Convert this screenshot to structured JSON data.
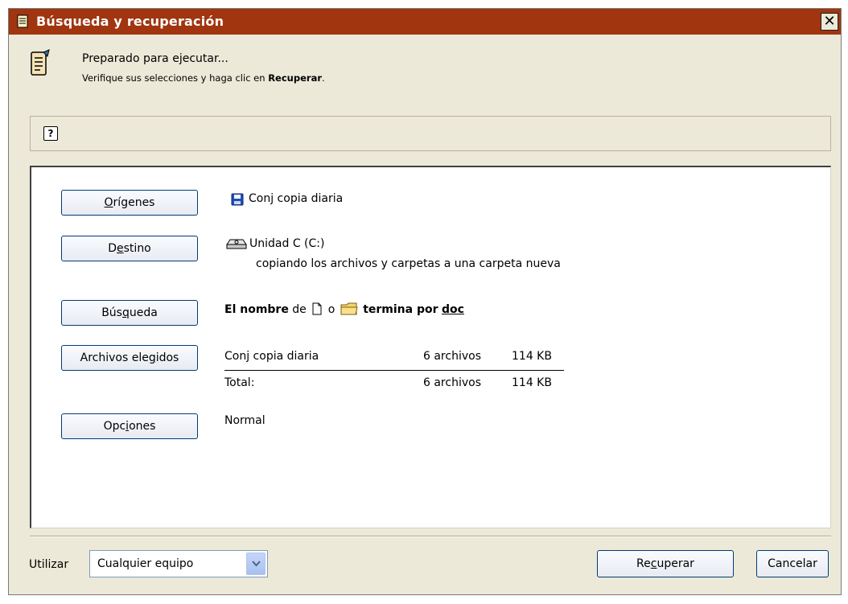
{
  "window": {
    "title": "Búsqueda y recuperación",
    "close_glyph": "✕",
    "title_icon": "document-icon"
  },
  "header": {
    "icon": "wizard-scroll-icon",
    "line1": "Preparado para ejecutar...",
    "line2_prefix": "Verifique sus selecciones y haga clic en ",
    "line2_bold": "Recuperar",
    "line2_suffix": "."
  },
  "helpbar": {
    "help_glyph": "?"
  },
  "panel": {
    "origenes": {
      "btn_pre": "",
      "btn_ul": "O",
      "btn_post": "rígenes",
      "value": "Conj copia diaria"
    },
    "destino": {
      "btn_pre": "D",
      "btn_ul": "e",
      "btn_post": "stino",
      "drive": "Unidad C (C:)",
      "note": "copiando los archivos y carpetas a una carpeta nueva"
    },
    "busqueda": {
      "btn_pre": "Bús",
      "btn_ul": "q",
      "btn_post": "ueda",
      "bold1": "El nombre",
      "de": "de",
      "o": "o",
      "bold2": "termina por",
      "ext": "doc"
    },
    "archivos": {
      "btn_pre": "Archivos ele",
      "btn_ul": "g",
      "btn_post": "idos",
      "rows": [
        {
          "name": "Conj copia diaria",
          "count": "6 archivos",
          "size": "114 KB"
        }
      ],
      "total": {
        "name": "Total:",
        "count": "6 archivos",
        "size": "114 KB"
      }
    },
    "opciones": {
      "btn_pre": "Opc",
      "btn_ul": "i",
      "btn_post": "ones",
      "value": "Normal"
    }
  },
  "footer": {
    "use_label": "Utilizar",
    "combo_value": "Cualquier equipo",
    "recover": {
      "pre": "Re",
      "ul": "c",
      "post": "uperar"
    },
    "cancel": "Cancelar"
  },
  "colors": {
    "titlebar": "#a0350f",
    "dialog_bg": "#ece9d8",
    "button_border": "#003c74"
  }
}
